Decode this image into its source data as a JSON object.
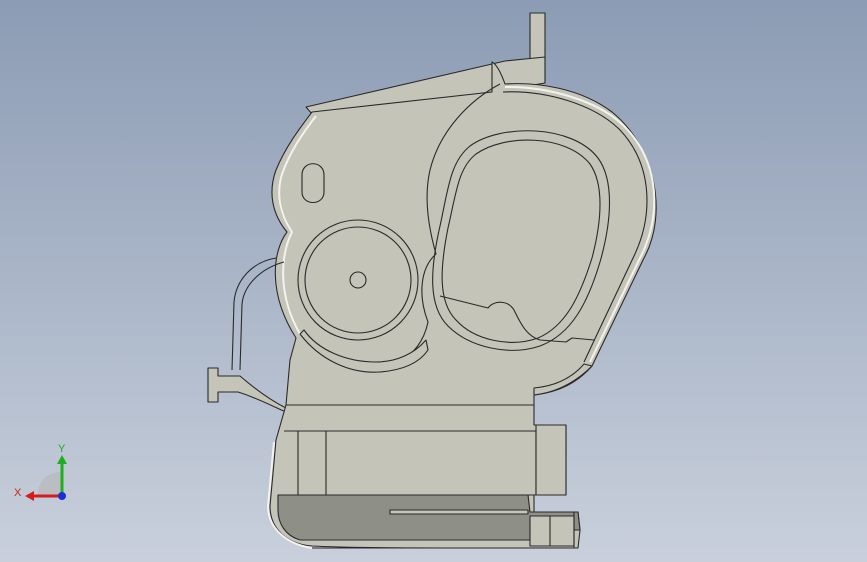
{
  "triad": {
    "x_label": "X",
    "y_label": "Y",
    "colors": {
      "x": "#d41c1c",
      "y": "#1fae1f",
      "z": "#1b2fd6"
    }
  },
  "model": {
    "body_color": "#c4c4b9",
    "shade_color": "#8e8f86",
    "edge_color": "#2a2a2a",
    "highlight_color": "#f3f3ee"
  }
}
